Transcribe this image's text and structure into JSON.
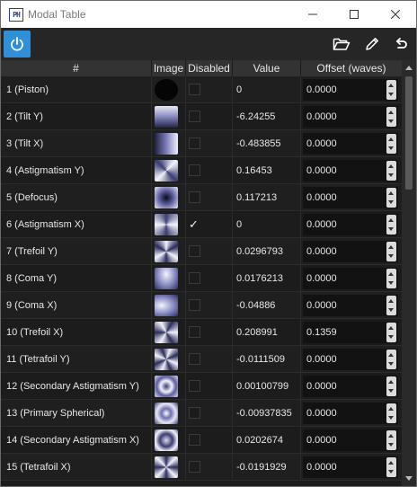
{
  "window": {
    "title": "Modal Table",
    "icon_text": "PH",
    "controls": [
      "minimize-icon",
      "maximize-icon",
      "close-icon"
    ]
  },
  "toolbar": {
    "power": "power-icon",
    "open": "folder-open-icon",
    "edit": "pencil-icon",
    "undo": "undo-icon",
    "accent": "#2f8fd8"
  },
  "table": {
    "columns": [
      "#",
      "Image",
      "Disabled",
      "Value",
      "Offset (waves)"
    ],
    "rows": [
      {
        "name": "1 (Piston)",
        "disabled": false,
        "value": "0",
        "offset": "0.0000"
      },
      {
        "name": "2 (Tilt Y)",
        "disabled": false,
        "value": "-6.24255",
        "offset": "0.0000"
      },
      {
        "name": "3 (Tilt X)",
        "disabled": false,
        "value": "-0.483855",
        "offset": "0.0000"
      },
      {
        "name": "4 (Astigmatism Y)",
        "disabled": false,
        "value": "0.16453",
        "offset": "0.0000"
      },
      {
        "name": "5 (Defocus)",
        "disabled": false,
        "value": "0.117213",
        "offset": "0.0000"
      },
      {
        "name": "6 (Astigmatism X)",
        "disabled": true,
        "value": "0",
        "offset": "0.0000"
      },
      {
        "name": "7 (Trefoil Y)",
        "disabled": false,
        "value": "0.0296793",
        "offset": "0.0000"
      },
      {
        "name": "8 (Coma Y)",
        "disabled": false,
        "value": "0.0176213",
        "offset": "0.0000"
      },
      {
        "name": "9 (Coma X)",
        "disabled": false,
        "value": "-0.04886",
        "offset": "0.0000"
      },
      {
        "name": "10 (Trefoil X)",
        "disabled": false,
        "value": "0.208991",
        "offset": "0.1359"
      },
      {
        "name": "11 (Tetrafoil Y)",
        "disabled": false,
        "value": "-0.0111509",
        "offset": "0.0000"
      },
      {
        "name": "12 (Secondary Astigmatism Y)",
        "disabled": false,
        "value": "0.00100799",
        "offset": "0.0000"
      },
      {
        "name": "13 (Primary Spherical)",
        "disabled": false,
        "value": "-0.00937835",
        "offset": "0.0000"
      },
      {
        "name": "14 (Secondary Astigmatism X)",
        "disabled": false,
        "value": "0.0202674",
        "offset": "0.0000"
      },
      {
        "name": "15 (Tetrafoil X)",
        "disabled": false,
        "value": "-0.0191929",
        "offset": "0.0000"
      }
    ]
  }
}
